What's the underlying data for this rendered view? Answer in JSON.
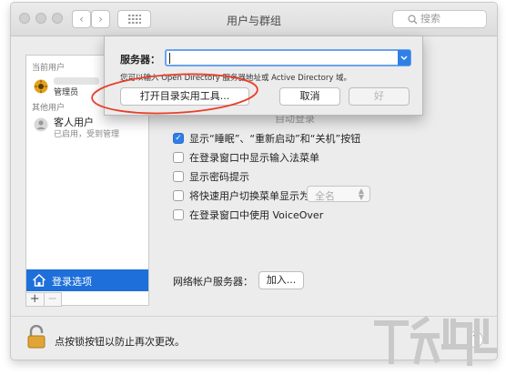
{
  "window": {
    "title": "用户与群组"
  },
  "search": {
    "placeholder": "搜索"
  },
  "sidebar": {
    "current_users_header": "当前用户",
    "current_user_role": "管理员",
    "other_users_header": "其他用户",
    "guest_name": "客人用户",
    "guest_status": "已启用，受到管理",
    "login_options_label": "登录选项",
    "add_symbol": "+",
    "remove_symbol": "−"
  },
  "sheet": {
    "server_label": "服务器：",
    "server_value": "",
    "hint": "您可以输入 Open Directory 服务器地址或 Active Directory 域。",
    "open_utility_label": "打开目录实用工具...",
    "cancel_label": "取消",
    "ok_label": "好"
  },
  "options": {
    "partial_hidden_text": "自动登录",
    "show_sleep_label": "显示“睡眠”、“重新启动”和“关机”按钮",
    "show_sleep_checked": true,
    "input_menu_label": "在登录窗口中显示输入法菜单",
    "password_hint_label": "显示密码提示",
    "fast_switch_label": "将快速用户切换菜单显示为",
    "fast_switch_value": "全名",
    "voiceover_label": "在登录窗口中使用 VoiceOver"
  },
  "network": {
    "label": "网络帐户服务器：",
    "join_label": "加入..."
  },
  "footer": {
    "lock_text": "点按锁按钮以防止再次更改。",
    "help_symbol": "?"
  },
  "colors": {
    "accent": "#2f7fe6",
    "annotation": "#e8402a",
    "sidebar_selected": "#1e6fd9"
  },
  "icons": [
    "back-icon",
    "forward-icon",
    "grid-icon",
    "search-icon",
    "user-avatar-icon",
    "guest-user-icon",
    "house-icon",
    "lock-icon",
    "help-icon",
    "dropdown-chevron-icon"
  ]
}
